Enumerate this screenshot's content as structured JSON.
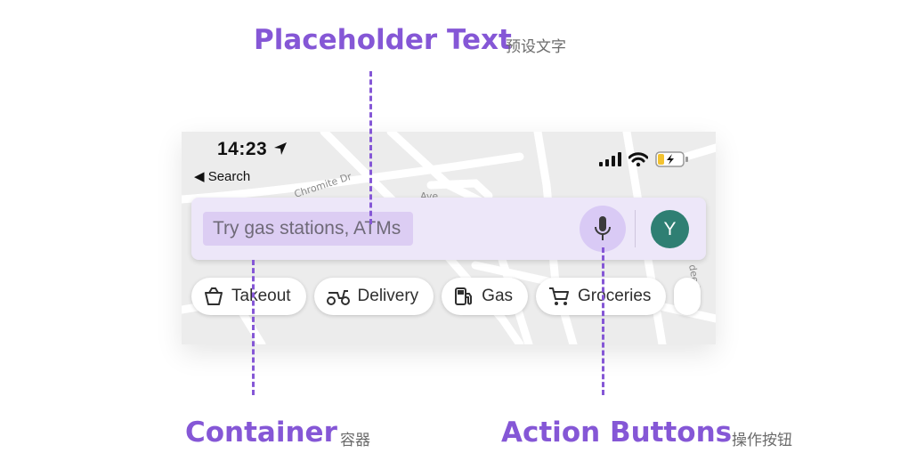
{
  "annotations": {
    "placeholder_title": "Placeholder Text",
    "placeholder_sub": "预设文字",
    "container_title": "Container",
    "container_sub": "容器",
    "actions_title": "Action Buttons",
    "actions_sub": "操作按钮"
  },
  "status_bar": {
    "time": "14:23",
    "back_label": "◀ Search",
    "icons": [
      "location-arrow-icon",
      "cellular-signal-icon",
      "wifi-icon",
      "battery-charging-icon"
    ]
  },
  "map_labels": {
    "street_1": "Chromite Dr",
    "street_2": "Ave",
    "street_3": "dee Dr"
  },
  "search": {
    "placeholder": "Try gas stations, ATMs",
    "mic_icon": "mic-icon",
    "avatar_letter": "Y"
  },
  "chips": [
    {
      "label": "Takeout",
      "icon": "takeout-icon"
    },
    {
      "label": "Delivery",
      "icon": "scooter-icon"
    },
    {
      "label": "Gas",
      "icon": "gas-pump-icon"
    },
    {
      "label": "Groceries",
      "icon": "cart-icon"
    }
  ],
  "colors": {
    "accent": "#8557d6",
    "search_bg": "#ede7f9",
    "placeholder_highlight": "#dccdf3",
    "mic_bg": "#d9caf5",
    "avatar": "#2f7f73",
    "battery": "#f2c230"
  }
}
